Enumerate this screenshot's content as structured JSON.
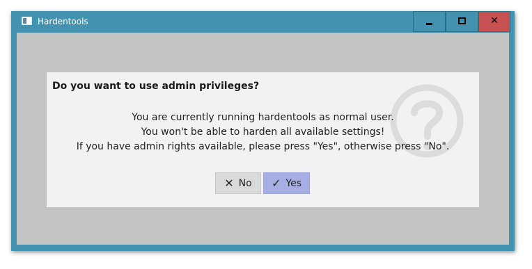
{
  "window": {
    "title": "Hardentools",
    "controls": {
      "minimize": "minimize-icon",
      "maximize": "maximize-icon",
      "close": "close-icon"
    },
    "close_glyph": "✕",
    "accent_color": "#4393b0",
    "close_color": "#c75050"
  },
  "dialog": {
    "title": "Do you want to use admin privileges?",
    "icon": "question-mark-icon",
    "message_lines": [
      "You are currently running hardentools as normal user.",
      "You won't be able to harden all available settings!",
      "If you have admin rights available, please press \"Yes\", otherwise press \"No\"."
    ],
    "buttons": {
      "no": {
        "label": "No",
        "icon": "x-icon",
        "glyph": "✕"
      },
      "yes": {
        "label": "Yes",
        "icon": "checkmark-icon",
        "glyph": "✓",
        "color": "#a6aee3"
      }
    }
  }
}
